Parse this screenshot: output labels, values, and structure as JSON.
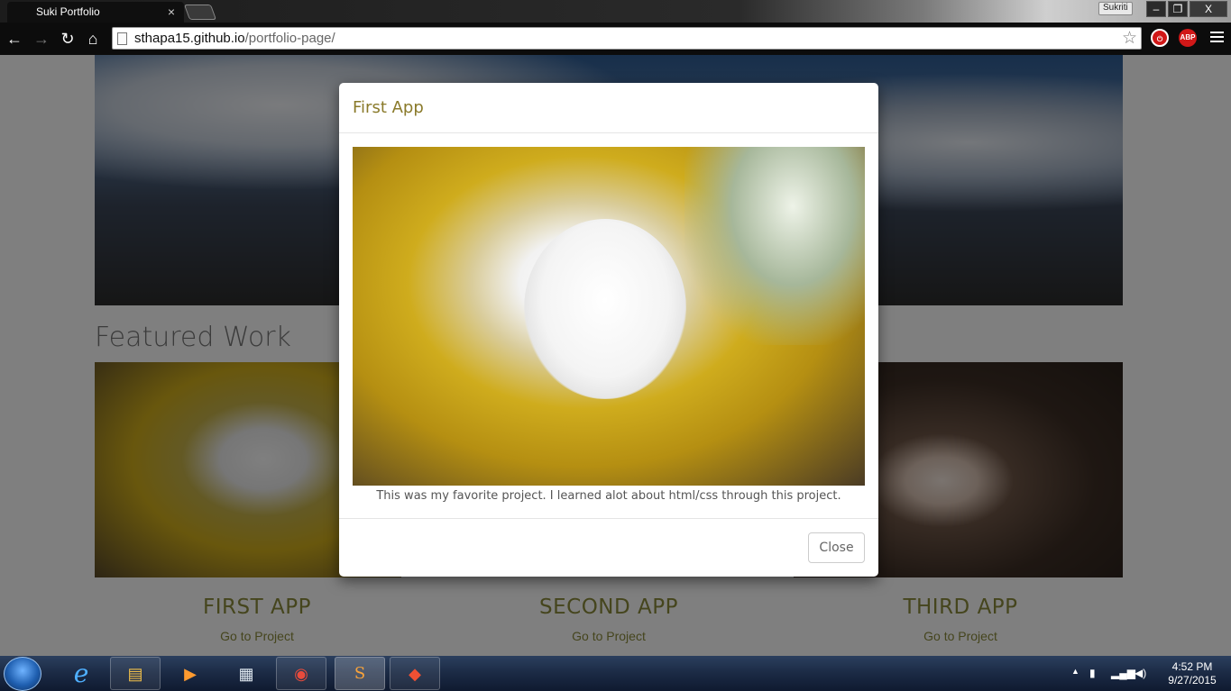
{
  "browser": {
    "tab_title": "Suki Portfolio",
    "tab_close": "×",
    "profile_name": "Sukriti",
    "window_controls": {
      "minimize": "–",
      "restore": "❐",
      "close": "X"
    },
    "url_host": "sthapa15.github.io",
    "url_path": "/portfolio-page/",
    "nav": {
      "back": "←",
      "forward": "→",
      "reload": "↻",
      "home": "⌂"
    },
    "bookmark_star": "☆",
    "extensions": [
      {
        "name": "stop-extension-icon",
        "label": "",
        "color": "#d11818"
      },
      {
        "name": "adblock-plus-icon",
        "label": "ABP",
        "color": "#d11818"
      }
    ]
  },
  "page": {
    "featured_heading": "Featured Work",
    "cards": [
      {
        "title": "FIRST APP",
        "link": "Go to Project"
      },
      {
        "title": "SECOND APP",
        "link": "Go to Project"
      },
      {
        "title": "THIRD APP",
        "link": "Go to Project"
      }
    ]
  },
  "modal": {
    "title": "First App",
    "caption": "This was my favorite project. I learned alot about html/css through this project.",
    "close_label": "Close"
  },
  "taskbar": {
    "apps": [
      {
        "name": "internet-explorer-icon",
        "glyph": "e"
      },
      {
        "name": "file-explorer-icon",
        "glyph": "▤"
      },
      {
        "name": "media-player-icon",
        "glyph": "▶"
      },
      {
        "name": "calculator-icon",
        "glyph": "▦"
      },
      {
        "name": "chrome-icon",
        "glyph": "◉"
      },
      {
        "name": "sublime-text-icon",
        "glyph": "S"
      },
      {
        "name": "git-icon",
        "glyph": "◆"
      }
    ],
    "time": "4:52 PM",
    "date": "9/27/2015",
    "tray_expand": "▲"
  },
  "colors": {
    "accent_text": "#8a8a3a",
    "modal_title": "#8a7a2a",
    "backdrop": "rgba(0,0,0,0.5)"
  }
}
